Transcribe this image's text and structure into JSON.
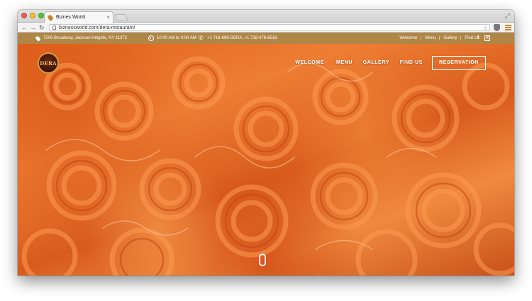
{
  "browser": {
    "tab_title": "Biznes World",
    "tab_close": "×",
    "url": "biznessworld.com/dera-restaurant/",
    "traffic_light_colors": [
      "#ec5f57",
      "#f3bf2f",
      "#58c23a"
    ],
    "accent_menu_color": "#d08a2a"
  },
  "infobar": {
    "address": "7209 Broadway, Jackson Heights, NY 11372",
    "hours": "10:00 AM to 4:00 AM",
    "phones": "+1 718-898-DERA, +1 718-476-6516",
    "links": [
      "Welcome",
      "Menu",
      "Gallery",
      "Find Us"
    ],
    "social": [
      "f",
      "✕"
    ],
    "bg_color": "#b08646"
  },
  "hero": {
    "logo_text": "DERA",
    "nav": [
      "WELCOME",
      "MENU",
      "GALLERY",
      "FIND US"
    ],
    "reservation_label": "RESERVATION"
  }
}
